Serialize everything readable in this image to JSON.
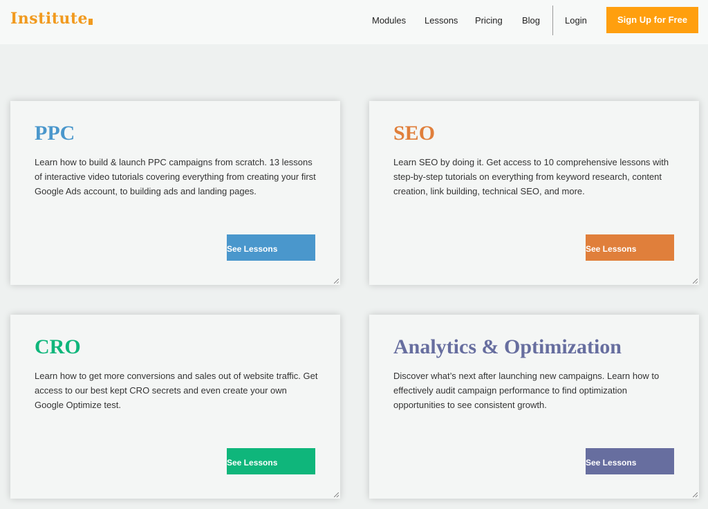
{
  "header": {
    "logo": "Institute",
    "nav": [
      "Modules",
      "Lessons",
      "Pricing",
      "Blog"
    ],
    "login": "Login",
    "signup": "Sign Up for Free",
    "brand_color": "#ff9f0e"
  },
  "cards": [
    {
      "title": "PPC",
      "description": "Learn how to build & launch PPC campaigns from scratch. 13 lessons of interactive video tutorials covering everything from creating your first Google Ads account, to building ads and landing pages.",
      "button": "See Lessons",
      "color": "#4a97cc"
    },
    {
      "title": "SEO",
      "description": "Learn SEO by doing it. Get access to 10 comprehensive lessons with step-by-step tutorials on everything from keyword research, content creation, link building, technical SEO, and more.",
      "button": "See Lessons",
      "color": "#e07f3b"
    },
    {
      "title": "CRO",
      "description": "Learn how to get more conversions and sales out of website traffic. Get access to our best kept CRO secrets and even create your own Google Optimize test.",
      "button": "See Lessons",
      "color": "#0fb67b"
    },
    {
      "title": "Analytics & Optimization",
      "description": "Discover what’s next after launching new campaigns. Learn how to effectively audit campaign performance to find optimization opportunities to see consistent growth.",
      "button": "See Lessons",
      "color": "#676e9f"
    }
  ]
}
